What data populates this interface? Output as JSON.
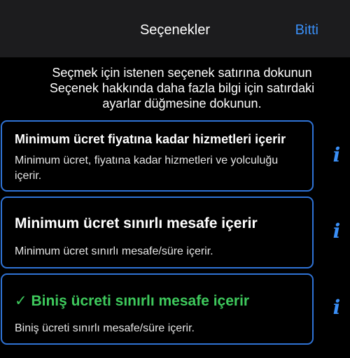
{
  "navbar": {
    "title": "Seçenekler",
    "done_label": "Bitti"
  },
  "instructions": {
    "line1": "Seçmek için istenen seçenek satırına dokunun",
    "line2": "Seçenek hakkında daha fazla bilgi için satırdaki",
    "line3": "ayarlar düğmesine dokunun."
  },
  "options": [
    {
      "title": "Minimum ücret fiyatına kadar hizmetleri içerir",
      "description": "Minimum ücret, fiyatına kadar hizmetleri ve yolculuğu içerir.",
      "selected": false
    },
    {
      "title": "Minimum ücret sınırlı mesafe içerir",
      "description": "Minimum ücret sınırlı mesafe/süre içerir.",
      "selected": false
    },
    {
      "check": "✓",
      "title": "Biniş ücreti sınırlı mesafe içerir",
      "description": "Biniş ücreti sınırlı mesafe/süre içerir.",
      "selected": true
    }
  ],
  "info_icon_glyph": "i",
  "colors": {
    "accent": "#3a8ff7",
    "border": "#2f73d6",
    "selected_text": "#3ec95c",
    "navbar_bg": "#1c1c1e",
    "background": "#000000"
  }
}
